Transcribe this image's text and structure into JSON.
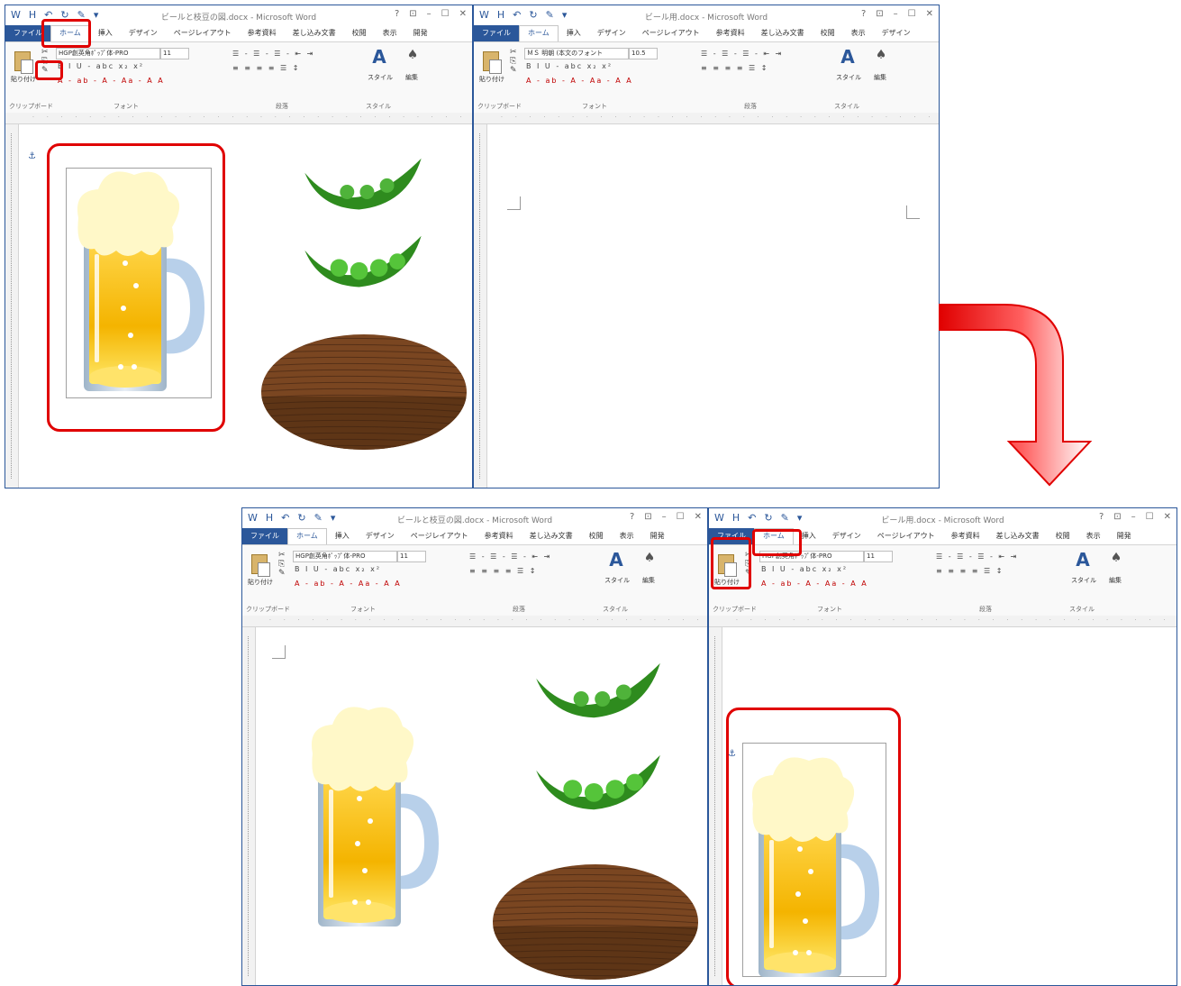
{
  "app": {
    "quick_access": [
      "W",
      "H",
      "↶",
      "↻",
      "✎",
      "▾"
    ],
    "window_controls": [
      "?",
      "⊡",
      "–",
      "☐",
      "✕"
    ],
    "ribbon": {
      "font_name_left": "HGP創英角ﾎﾟｯﾌﾟ体-PRO",
      "font_size_left": "11",
      "font_name_right": "ＭＳ 明朝 (本文のフォント",
      "font_size_right": "10.5",
      "paste_label": "貼り付け",
      "styles_label": "スタイル",
      "edit_label": "編集",
      "group_labels": [
        "クリップボード",
        "フォント",
        "段落",
        "スタイル"
      ],
      "glyphs_row1": "B I U - abc x₂ x²",
      "glyphs_row2": "A - ab - A - Aa - A A",
      "glyphs_para1": "☰ - ☰ - ☰ -  ⇤ ⇥",
      "glyphs_para2": "≡ ≡ ≡ ≡ ☰ ↕",
      "styles_icon": "A",
      "edit_icon": "♠"
    }
  },
  "windows": {
    "top_left": {
      "title": "ビールと枝豆の図.docx - Microsoft Word",
      "tabs": [
        "ファイル",
        "ホーム",
        "挿入",
        "デザイン",
        "ページレイアウト",
        "参考資料",
        "差し込み文書",
        "校閲",
        "表示",
        "開発"
      ]
    },
    "top_right": {
      "title": "ビール用.docx - Microsoft Word",
      "tabs": [
        "ファイル",
        "ホーム",
        "挿入",
        "デザイン",
        "ページレイアウト",
        "参考資料",
        "差し込み文書",
        "校閲",
        "表示",
        "デザイン"
      ]
    },
    "bottom_left": {
      "title": "ビールと枝豆の図.docx - Microsoft Word",
      "tabs": [
        "ファイル",
        "ホーム",
        "挿入",
        "デザイン",
        "ページレイアウト",
        "参考資料",
        "差し込み文書",
        "校閲",
        "表示",
        "開発"
      ]
    },
    "bottom_right": {
      "title": "ビール用.docx - Microsoft Word",
      "tabs": [
        "ファイル",
        "ホーム",
        "挿入",
        "デザイン",
        "ページレイアウト",
        "参考資料",
        "差し込み文書",
        "校閲",
        "表示",
        "開発"
      ]
    }
  },
  "colors": {
    "highlight_red": "#e00000",
    "word_blue": "#2b579a",
    "beer_gold": "#f5b800",
    "foam": "#fff8c8",
    "mug_handle": "#b8d0ea",
    "edamame": "#3a9a1f",
    "wood": "#6b3d1a"
  }
}
